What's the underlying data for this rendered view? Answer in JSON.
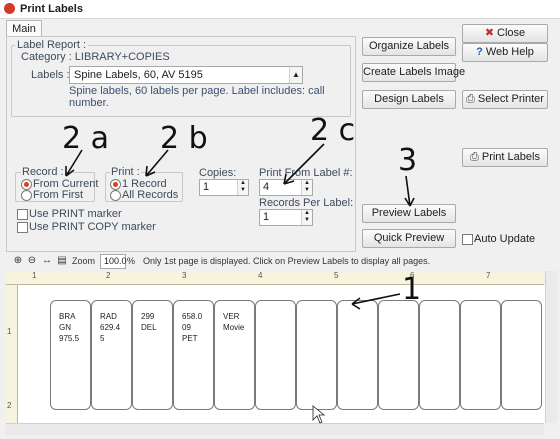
{
  "window": {
    "title": "Print Labels"
  },
  "tabs": [
    {
      "label": "Main"
    }
  ],
  "label_report": {
    "group_title": "Label Report :",
    "category_text": "Category : LIBRARY+COPIES",
    "labels_caption": "Labels :",
    "labels_value": "Spine Labels, 60, AV 5195",
    "description_line1": "Spine labels, 60 labels per page. Label includes: call",
    "description_line2": "number."
  },
  "record": {
    "title": "Record :",
    "options": [
      "From Current",
      "From First"
    ],
    "selected": "From Current"
  },
  "print": {
    "title": "Print :",
    "options": [
      "1 Record",
      "All Records"
    ],
    "selected": "1 Record"
  },
  "copies": {
    "label": "Copies:",
    "value": "1"
  },
  "print_from": {
    "label": "Print From Label #:",
    "value": "4"
  },
  "records_per_label": {
    "label": "Records Per Label:",
    "value": "1"
  },
  "checkboxes": [
    {
      "label": "Use PRINT marker",
      "checked": false
    },
    {
      "label": "Use PRINT COPY marker",
      "checked": false
    }
  ],
  "buttons": {
    "organize": "Organize Labels",
    "create_image": "Create Labels Image",
    "design": "Design Labels",
    "preview": "Preview Labels",
    "quick_preview": "Quick Preview",
    "close": "Close",
    "web_help": "Web Help",
    "select_printer": "Select Printer",
    "print_labels": "Print Labels"
  },
  "auto_update": {
    "label": "Auto Update",
    "checked": false
  },
  "toolbar": {
    "zoom_label": "Zoom",
    "zoom_value": "100.0",
    "zoom_unit": "%",
    "info": "Only 1st page is displayed. Click on Preview Labels to display all pages."
  },
  "ruler": {
    "h_numbers": [
      "1",
      "2",
      "3",
      "4",
      "5",
      "6",
      "7"
    ],
    "v_numbers": [
      "1",
      "2"
    ]
  },
  "label_cards": [
    {
      "lines": [
        "BRA",
        "GN",
        "975.5"
      ]
    },
    {
      "lines": [
        "RAD",
        "629.4",
        "5"
      ]
    },
    {
      "lines": [
        "299",
        "DEL"
      ]
    },
    {
      "lines": [
        "658.0",
        "09",
        "PET"
      ]
    },
    {
      "lines": [
        "VER",
        "Movie"
      ]
    },
    {
      "lines": []
    },
    {
      "lines": []
    },
    {
      "lines": []
    },
    {
      "lines": []
    },
    {
      "lines": []
    },
    {
      "lines": []
    },
    {
      "lines": []
    }
  ],
  "annotations": [
    "2 a",
    "2 b",
    "2 c",
    "3",
    "1"
  ],
  "colors": {
    "radio_selected": "#d8421f",
    "app_icon": "#d23a2a",
    "ruler_bg": "#f6f3df"
  },
  "icons": [
    "app-icon",
    "close-x-icon",
    "help-icon",
    "printer-icon",
    "zoom-in-icon",
    "zoom-out-icon",
    "fit-width-icon",
    "page-icon"
  ]
}
